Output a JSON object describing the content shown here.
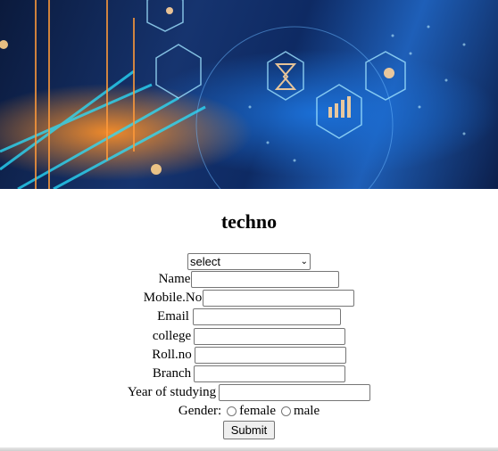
{
  "banner": {
    "icon": "technology-network-banner"
  },
  "page": {
    "title": "techno"
  },
  "form": {
    "select": {
      "value": "select"
    },
    "fields": {
      "name": {
        "label": "Name",
        "value": ""
      },
      "mobile": {
        "label": "Mobile.No",
        "value": ""
      },
      "email": {
        "label": "Email",
        "value": ""
      },
      "college": {
        "label": "college",
        "value": ""
      },
      "rollno": {
        "label": "Roll.no",
        "value": ""
      },
      "branch": {
        "label": "Branch",
        "value": ""
      },
      "year": {
        "label": "Year of studying",
        "value": ""
      }
    },
    "gender": {
      "label": "Gender:",
      "female": "female",
      "male": "male"
    },
    "submit": "Submit"
  }
}
